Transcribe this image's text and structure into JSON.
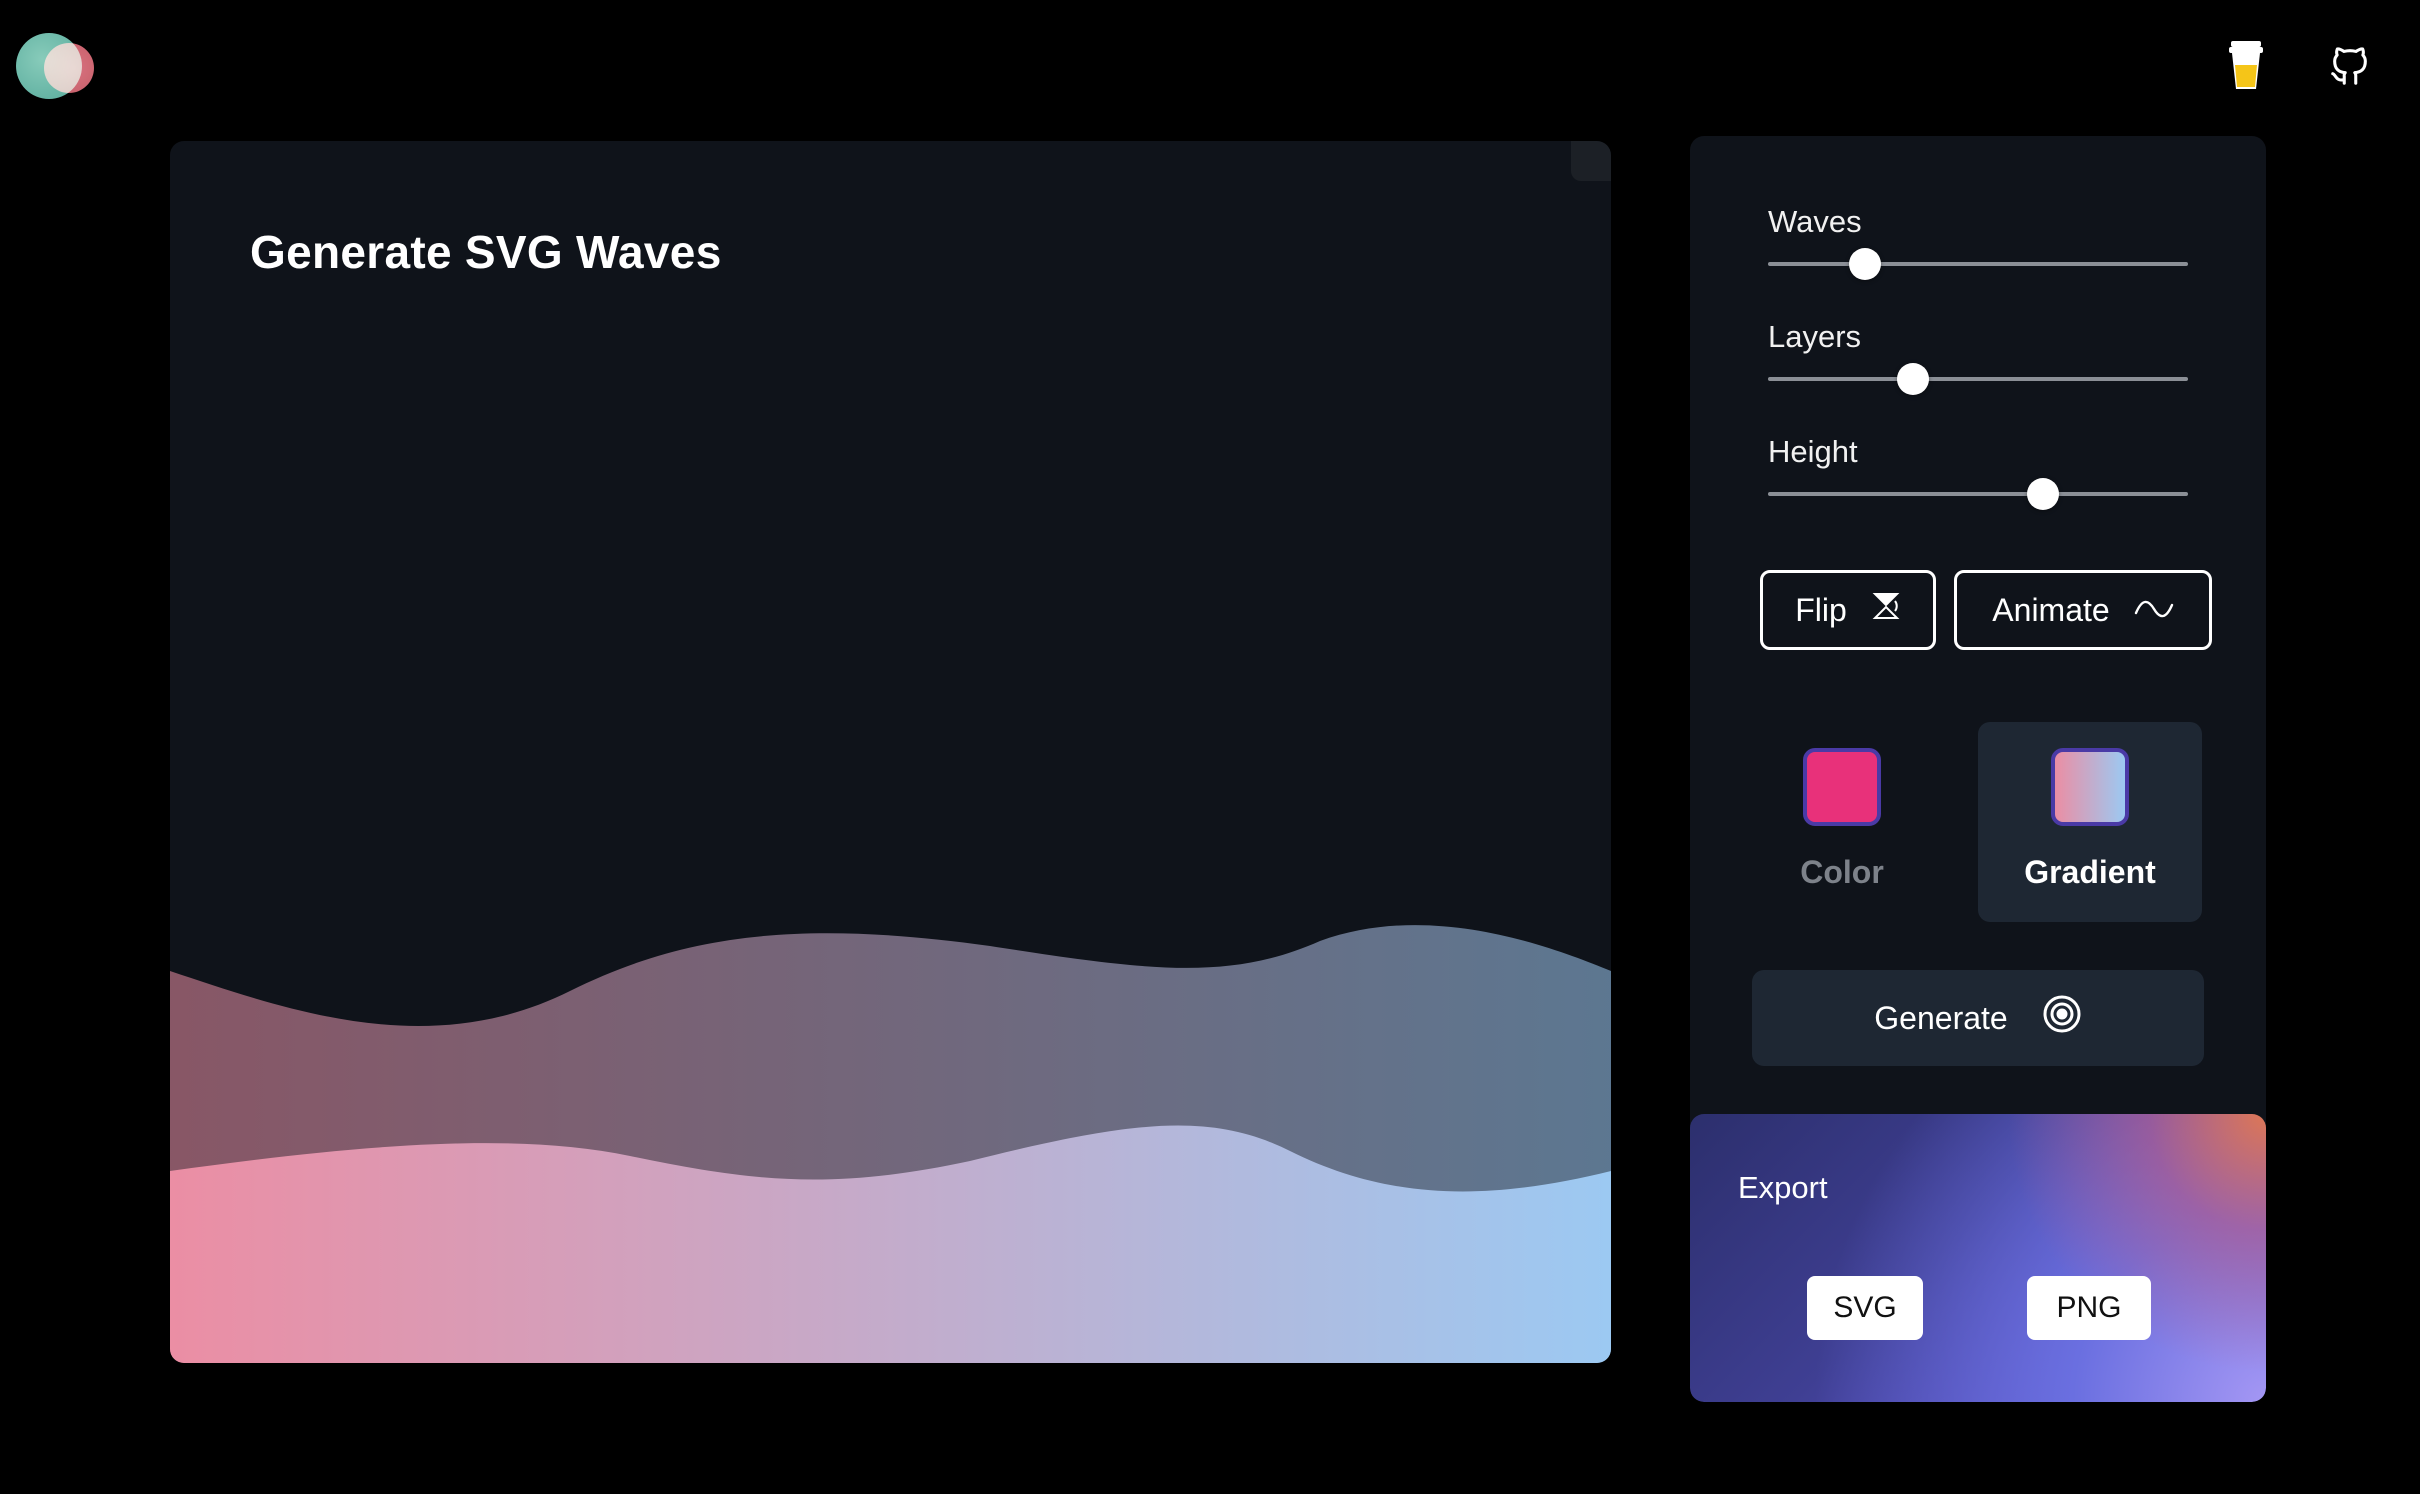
{
  "header": {
    "logo_icon": "app-logo-circles",
    "coffee_icon": "coffee-cup-icon",
    "github_icon": "github-icon"
  },
  "preview": {
    "title": "Generate SVG Waves",
    "gradient_colors": [
      "#eb8ea4",
      "#9cc9f2"
    ]
  },
  "controls": {
    "sliders": [
      {
        "label": "Waves",
        "value_fraction": 0.23
      },
      {
        "label": "Layers",
        "value_fraction": 0.345
      },
      {
        "label": "Height",
        "value_fraction": 0.655
      }
    ],
    "flip_label": "Flip",
    "animate_label": "Animate",
    "modes": {
      "color_label": "Color",
      "gradient_label": "Gradient",
      "color_swatch": "#e8317a",
      "selected": "Gradient"
    },
    "generate_label": "Generate"
  },
  "export": {
    "title": "Export",
    "svg_label": "SVG",
    "png_label": "PNG"
  }
}
